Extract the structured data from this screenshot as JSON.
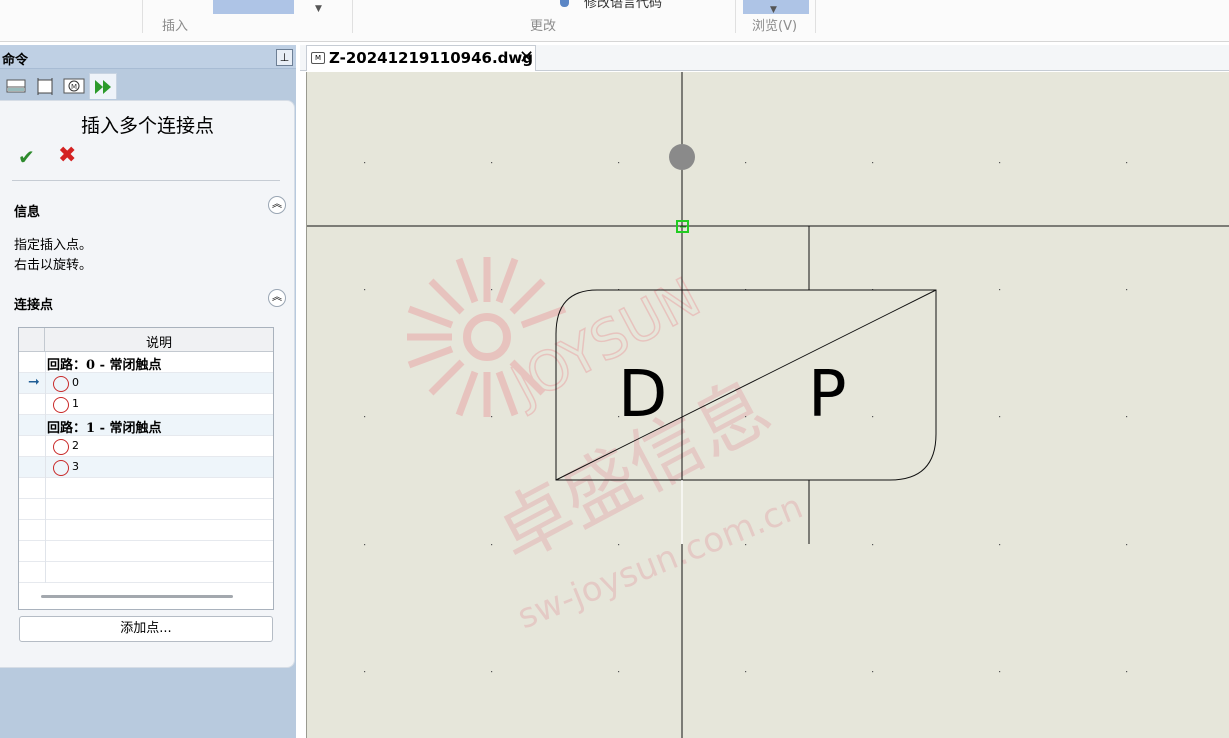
{
  "ribbon": {
    "insert_group_label": "插入",
    "modify_group_label": "更改",
    "browse_group_label": "浏览(V)",
    "cut_off_button_text": "修改语言代码"
  },
  "panel": {
    "title": "命令",
    "pin_label": "⊥",
    "property_manager": {
      "title": "插入多个连接点",
      "ok_label": "✔",
      "cancel_label": "✖",
      "info_section": {
        "title": "信息",
        "lines": [
          "指定插入点。",
          "右击以旋转。"
        ]
      },
      "points_section": {
        "title": "连接点",
        "column_header": "说明",
        "rows": [
          {
            "type": "group",
            "text": "回路：0 - 常闭触点"
          },
          {
            "type": "point",
            "num": "0",
            "current": true
          },
          {
            "type": "point",
            "num": "1"
          },
          {
            "type": "group",
            "text": "回路：1 - 常闭触点"
          },
          {
            "type": "point",
            "num": "2"
          },
          {
            "type": "point",
            "num": "3"
          }
        ]
      },
      "add_button": "添加点..."
    }
  },
  "document": {
    "tab_name": "Z-20241219110946.dwg",
    "tab_icon_label": "M",
    "close_label": "✕"
  },
  "drawing": {
    "letter_left": "D",
    "letter_right": "P",
    "watermark_brand": "JOYSUN",
    "watermark_cn": "卓盛信息",
    "watermark_url": "sw-joysun.com.cn"
  },
  "colors": {
    "canvas_bg": "#e6e6da",
    "accent_green": "#2d8a2d",
    "accent_red": "#d42222",
    "snap_green": "#22cc22",
    "watermark": "#e8a8a8"
  }
}
